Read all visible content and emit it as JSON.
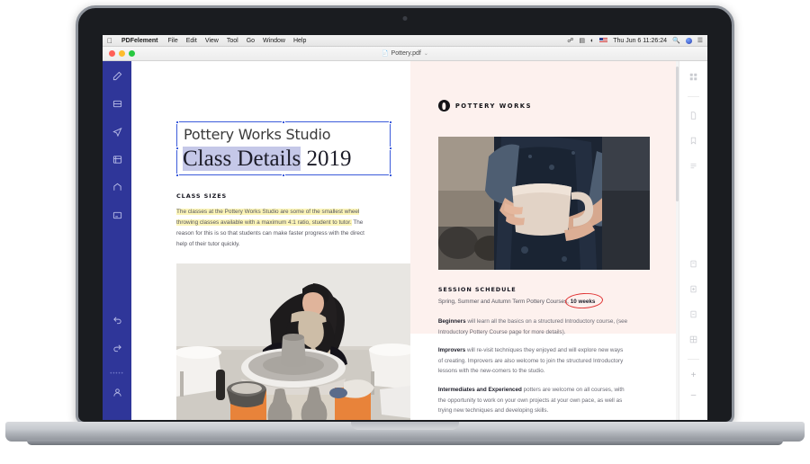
{
  "menubar": {
    "apple_logo": "apple-logo",
    "app_name": "PDFelement",
    "items": [
      "File",
      "Edit",
      "View",
      "Tool",
      "Go",
      "Window",
      "Help"
    ],
    "status_icons": [
      "bluetooth-icon",
      "display-icon",
      "wifi-icon",
      "flag-icon"
    ],
    "clock": "Thu Jun 6  11:26:24",
    "search_icon": "search-icon",
    "siri_icon": "siri-icon",
    "control_center_icon": "control-center-icon"
  },
  "titlebar": {
    "close_label": "close-button",
    "minimize_label": "minimize-button",
    "maximize_label": "maximize-button",
    "doc_icon": "document-icon",
    "doc_title": "Pottery.pdf",
    "chevron": "⌄"
  },
  "left_toolbar": {
    "background": "#2f3699",
    "items": [
      {
        "name": "pen-tool-icon"
      },
      {
        "name": "stamp-tool-icon"
      },
      {
        "name": "comment-tool-icon"
      },
      {
        "name": "form-tool-icon"
      },
      {
        "name": "signature-tool-icon"
      },
      {
        "name": "note-tool-icon"
      }
    ],
    "bottom_items": [
      {
        "name": "undo-arrow-icon"
      },
      {
        "name": "redo-arrow-icon"
      },
      {
        "name": "account-icon"
      }
    ],
    "dots": "•••••"
  },
  "right_toolbar": {
    "items": [
      {
        "name": "thumbnail-grid-icon"
      },
      {
        "name": "page-icon"
      },
      {
        "name": "bookmark-icon"
      },
      {
        "name": "outline-list-icon"
      }
    ],
    "lower_items": [
      {
        "name": "extract-page-icon"
      },
      {
        "name": "insert-page-icon"
      },
      {
        "name": "delete-page-icon"
      },
      {
        "name": "split-page-icon"
      }
    ],
    "zoom_in": "+",
    "zoom_out": "–"
  },
  "document": {
    "left_page": {
      "title_line1": "Pottery Works Studio",
      "title_line2_highlighted": "Class Details",
      "title_line2_rest": " 2019",
      "section_heading": "CLASS SIZES",
      "body_highlighted": "The classes at the Pottery Works Studio are some of the smallest wheel throwing classes available with a maximum 4:1 ratio, student to tutor.",
      "body_rest": " The reason for this is so that students can make faster progress with the direct help of their tutor quickly.",
      "photo_alt": "woman-throwing-pot-on-wheel-photo"
    },
    "right_page": {
      "brand_name": "POTTERY WORKS",
      "brand_mark": "pottery-vessel-logo",
      "photo_alt": "hands-holding-ceramic-mug-photo",
      "section_heading": "SESSION SCHEDULE",
      "schedule_line_prefix": "Spring, Summer and Autumn Term Pottery Courses, ",
      "schedule_line_emphasis": "10 weeks",
      "annotation": "red-ellipse-annotation",
      "paragraphs": [
        {
          "lead": "Beginners",
          "text": " will learn all the basics on a structured Introductory course, (see Introductory Pottery Course page for more details)."
        },
        {
          "lead": "Improvers",
          "text": " will re-visit techniques they enjoyed and will explore new ways of creating. Improvers are also welcome to join the structured Introductory lessons with the new-comers to the studio."
        },
        {
          "lead": "Intermediates and Experienced",
          "text": " potters are welcome on all courses, with the opportunity to work on your own projects at your own pace, as well as trying new techniques and developing skills."
        }
      ]
    }
  },
  "colors": {
    "sidebar_blue": "#2f3699",
    "page_pink": "#fdf1ee",
    "highlight_yellow": "#fcf5b8",
    "selection_blue": "#c5c8e8",
    "annotation_red": "#e03030"
  }
}
